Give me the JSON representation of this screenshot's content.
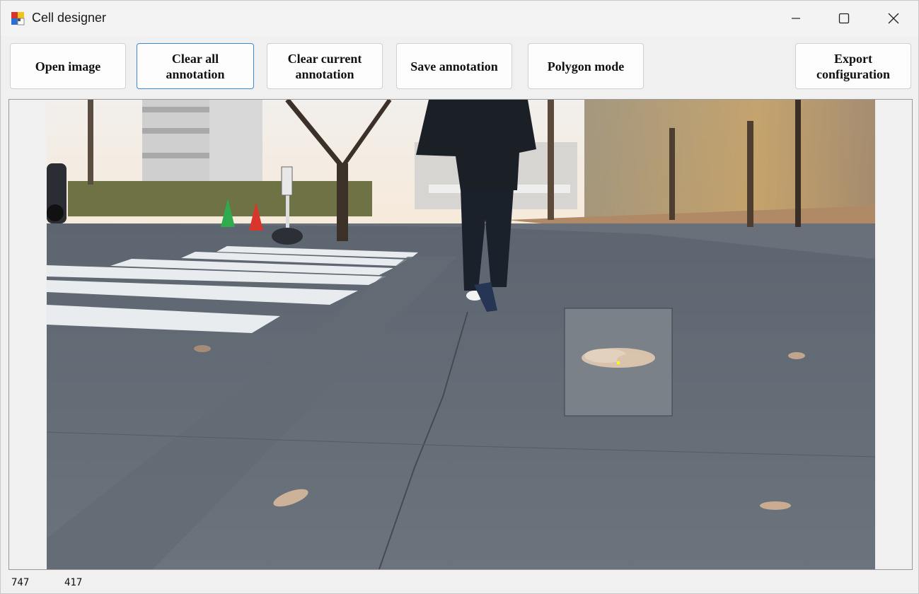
{
  "window": {
    "title": "Cell designer"
  },
  "toolbar": {
    "open_image": "Open image",
    "clear_all_line1": "Clear all",
    "clear_all_line2": "annotation",
    "clear_current_line1": "Clear current",
    "clear_current_line2": "annotation",
    "save_annotation": "Save annotation",
    "polygon_mode": "Polygon mode",
    "export_line1": "Export",
    "export_line2": "configuration"
  },
  "image_view": {
    "description_icon": "photo-street-scene",
    "magnifier_icon": "zoom-lens"
  },
  "status": {
    "x": "747",
    "y": "417"
  },
  "colors": {
    "focus_accent": "#3c8ad8",
    "cursor_dot": "#ffff00"
  }
}
